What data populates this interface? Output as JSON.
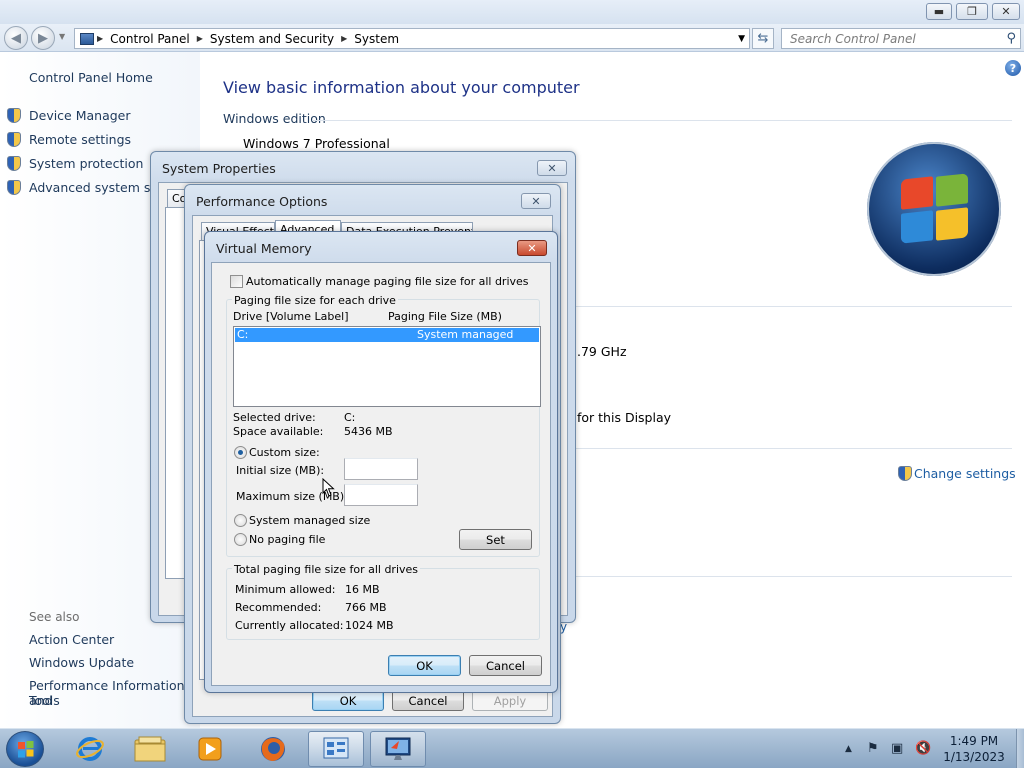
{
  "window": {
    "caption_min": "▬",
    "caption_max": "❐",
    "caption_close": "✕"
  },
  "address_bar": {
    "breadcrumbs": [
      "Control Panel",
      "System and Security",
      "System"
    ],
    "search_placeholder": "Search Control Panel"
  },
  "left_pane": {
    "home": "Control Panel Home",
    "tasks": [
      "Device Manager",
      "Remote settings",
      "System protection",
      "Advanced system settings"
    ],
    "see_also_heading": "See also",
    "see_also": [
      "Action Center",
      "Windows Update",
      "Performance Information and",
      "Tools"
    ]
  },
  "main": {
    "title": "View basic information about your computer",
    "edition_heading": "Windows edition",
    "edition": "Windows 7 Professional",
    "cpu_speed_fragment": ".79 GHz",
    "display_fragment": "for this Display",
    "change_settings": "Change settings",
    "partial_link": "y"
  },
  "system_properties": {
    "title": "System Properties",
    "first_tab_fragment": "Co",
    "buttons": {
      "ok": "OK",
      "cancel": "Cancel",
      "apply": "Apply"
    }
  },
  "performance_options": {
    "title": "Performance Options",
    "tabs": [
      "Visual Effects",
      "Advanced",
      "Data Execution Prevention"
    ]
  },
  "virtual_memory": {
    "title": "Virtual Memory",
    "auto_manage_label": "Automatically manage paging file size for all drives",
    "auto_manage_checked": false,
    "per_drive_group": "Paging file size for each drive",
    "col_drive": "Drive  [Volume Label]",
    "col_size": "Paging File Size (MB)",
    "drives": [
      {
        "drive": "C:",
        "size": "System managed",
        "selected": true
      }
    ],
    "selected_drive_label": "Selected drive:",
    "selected_drive_value": "C:",
    "space_available_label": "Space available:",
    "space_available_value": "5436 MB",
    "custom_size_label": "Custom size:",
    "initial_size_label": "Initial size (MB):",
    "initial_size_value": "",
    "max_size_label": "Maximum size (MB):",
    "max_size_value": "",
    "system_managed_label": "System managed size",
    "no_paging_label": "No paging file",
    "selected_option": "custom",
    "set_button": "Set",
    "total_group": "Total paging file size for all drives",
    "min_allowed_label": "Minimum allowed:",
    "min_allowed_value": "16 MB",
    "recommended_label": "Recommended:",
    "recommended_value": "766 MB",
    "allocated_label": "Currently allocated:",
    "allocated_value": "1024 MB",
    "ok": "OK",
    "cancel": "Cancel"
  },
  "taskbar": {
    "items": [
      "internet-explorer",
      "windows-explorer",
      "media-player",
      "firefox",
      "control-panel",
      "system-properties"
    ],
    "time": "1:49 PM",
    "date": "1/13/2023"
  }
}
